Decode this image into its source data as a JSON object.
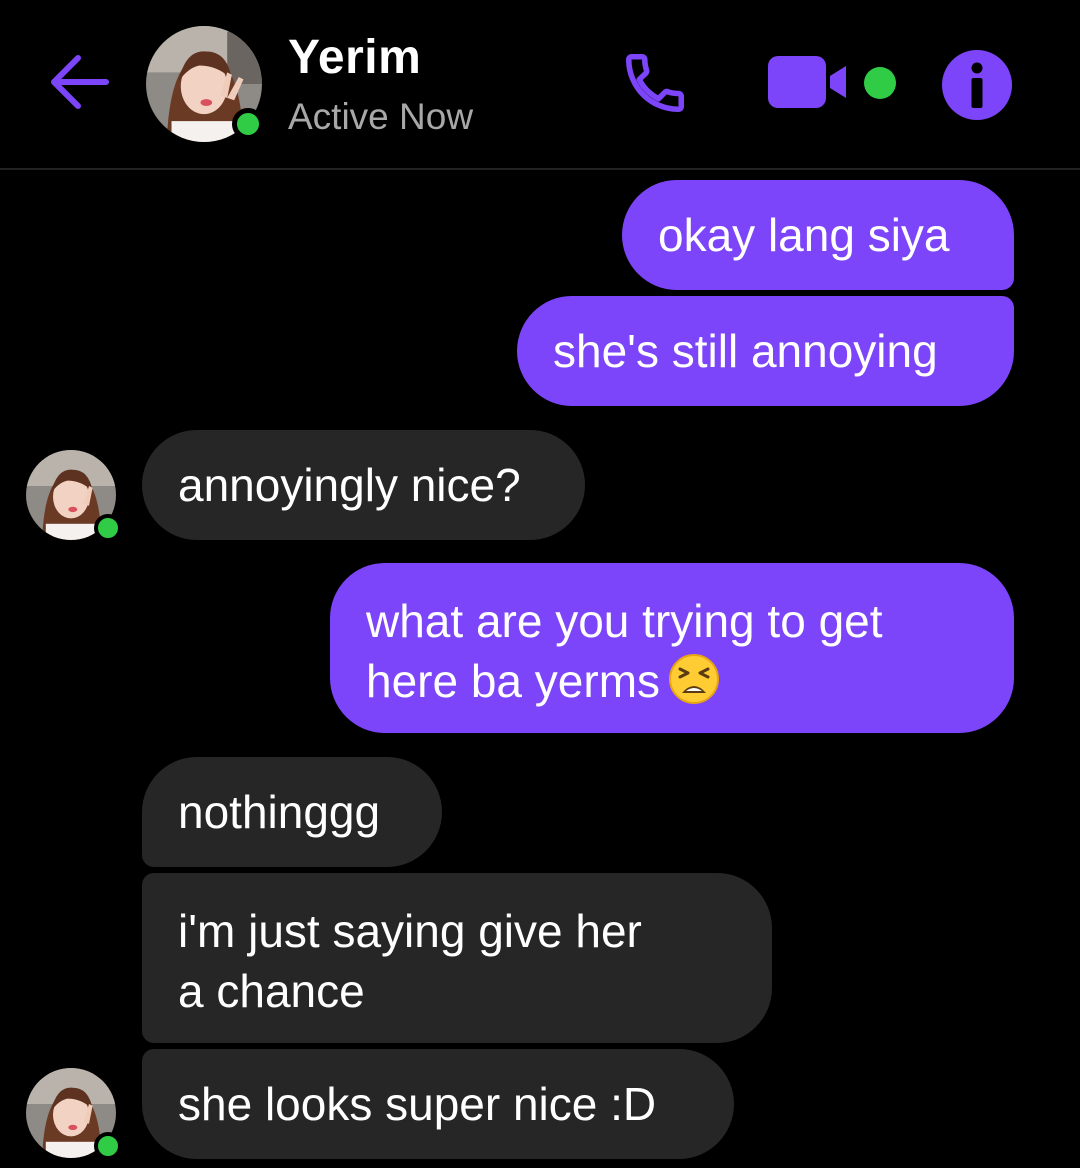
{
  "header": {
    "contact_name": "Yerim",
    "status": "Active Now",
    "accent_color": "#7d45f9",
    "online_color": "#31cc46",
    "icons": [
      "back-arrow-icon",
      "phone-icon",
      "video-camera-icon",
      "info-icon"
    ]
  },
  "messages": [
    {
      "direction": "sent",
      "text": "okay lang siya"
    },
    {
      "direction": "sent",
      "text": "she's still annoying"
    },
    {
      "direction": "received",
      "text": "annoyingly nice?"
    },
    {
      "direction": "sent",
      "lines": [
        "what are you trying to get",
        "here ba yerms"
      ],
      "emoji": "tired-face-emoji"
    },
    {
      "direction": "received",
      "text": "nothinggg"
    },
    {
      "direction": "received",
      "lines": [
        "i'm just saying give her",
        "a chance"
      ]
    },
    {
      "direction": "received",
      "text": "she looks super nice :D"
    }
  ],
  "theme": {
    "background": "#000000",
    "sent_bubble": "#7d45f9",
    "received_bubble": "#262626",
    "status_text": "#a8a8a8"
  }
}
